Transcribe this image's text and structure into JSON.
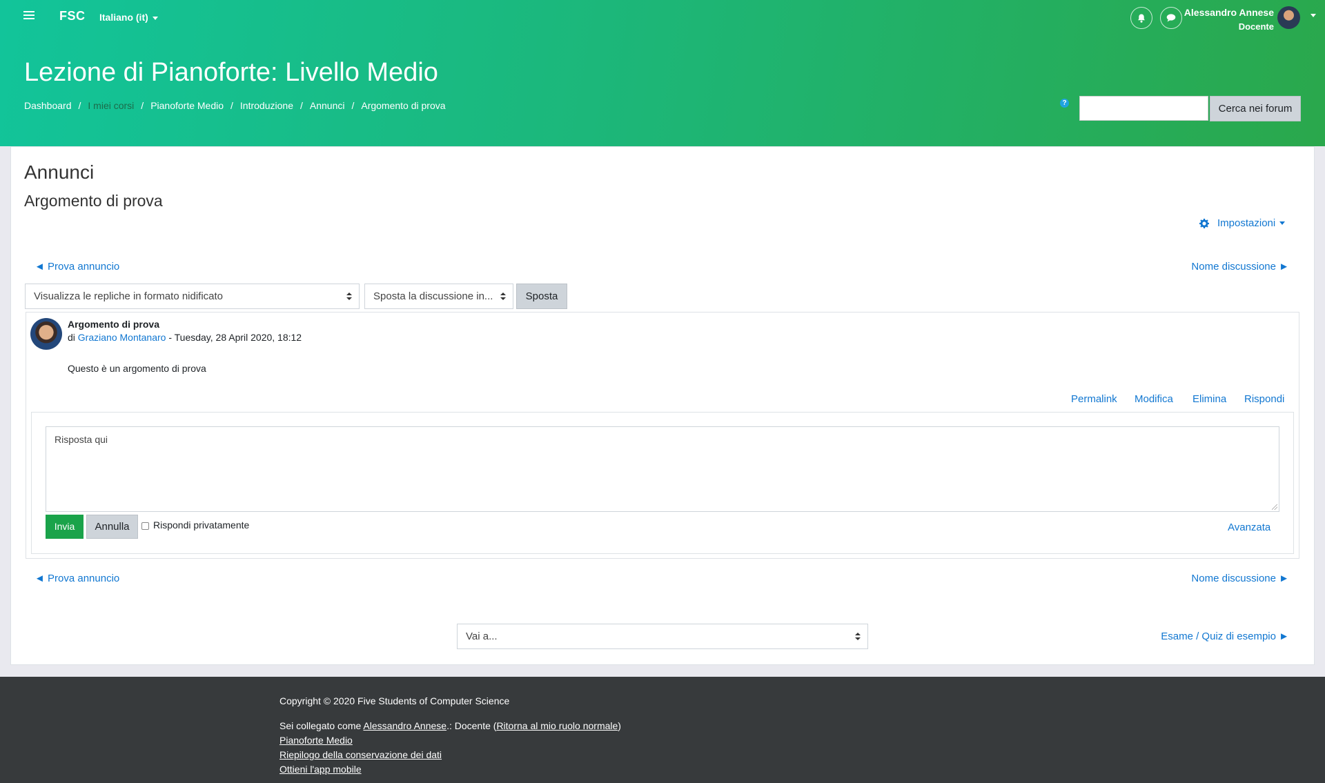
{
  "navbar": {
    "brand": "FSC",
    "language": "Italiano (it)",
    "user_name": "Alessandro Annese",
    "user_role": "Docente",
    "icons": [
      "menu-icon",
      "bell-icon",
      "chat-icon"
    ]
  },
  "header": {
    "title": "Lezione di Pianoforte: Livello Medio",
    "breadcrumb": [
      "Dashboard",
      "I miei corsi",
      "Pianoforte Medio",
      "Introduzione",
      "Annunci",
      "Argomento di prova"
    ],
    "search_button": "Cerca nei forum",
    "search_value": "",
    "help_icon": "?"
  },
  "main": {
    "forum_name": "Annunci",
    "discussion_name": "Argomento di prova",
    "settings_label": "Impostazioni",
    "prev_discussion": "◄ Prova annuncio",
    "next_discussion": "Nome discussione ►",
    "display_mode": "Visualizza le repliche in formato nidificato",
    "move_select": "Sposta la discussione in...",
    "move_button": "Sposta",
    "post": {
      "subject": "Argomento di prova",
      "by_prefix": "di",
      "author": "Graziano Montanaro",
      "date": "- Tuesday, 28 April 2020, 18:12",
      "message": "Questo è un argomento di prova",
      "actions": [
        "Permalink",
        "Modifica",
        "Elimina",
        "Rispondi"
      ]
    },
    "reply": {
      "placeholder": "Risposta qui",
      "send": "Invia",
      "cancel": "Annulla",
      "private": "Rispondi privatamente",
      "advanced": "Avanzata"
    },
    "jump_to": "Vai a...",
    "next_activity": "Esame / Quiz di esempio ►"
  },
  "footer": {
    "copyright": "Copyright © 2020 Five Students of Computer Science",
    "logged_prefix": "Sei collegato come",
    "logged_user": "Alessandro Annese",
    "logged_mid": ".: Docente (",
    "return_role": "Ritorna al mio ruolo normale",
    "logged_suffix": ")",
    "links": [
      "Pianoforte Medio",
      "Riepilogo della conservazione dei dati",
      "Ottieni l'app mobile"
    ]
  }
}
